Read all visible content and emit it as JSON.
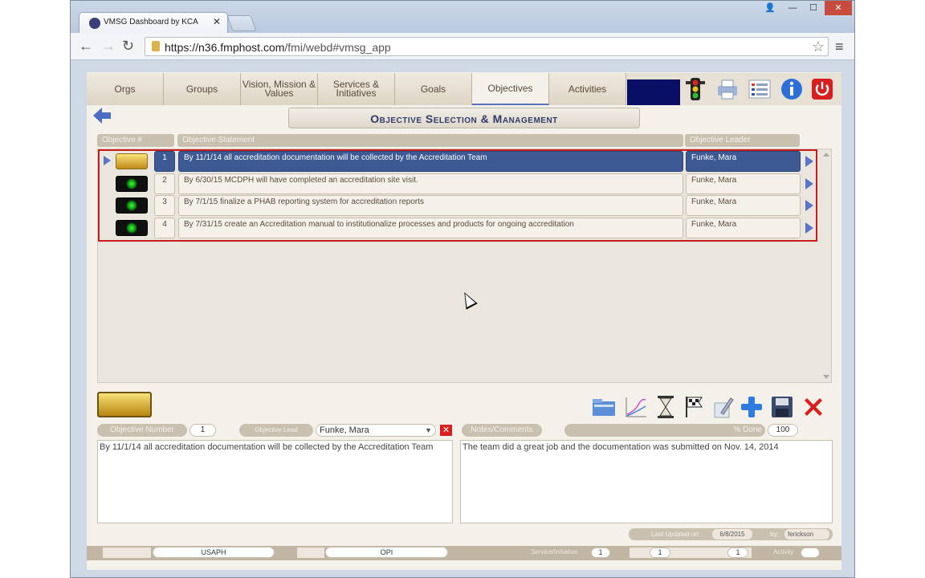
{
  "browser": {
    "tab_title": "VMSG Dashboard by KCA",
    "url_host": "https://n36.fmphost.com",
    "url_path": "/fmi/webd#vmsg_app",
    "controls": {
      "user": "👤",
      "min": "—",
      "max": "☐",
      "close": "✕"
    }
  },
  "nav": {
    "tabs": [
      {
        "label": "Orgs"
      },
      {
        "label": "Groups"
      },
      {
        "label": "Vision, Mission & Values"
      },
      {
        "label": "Services & Initiatives"
      },
      {
        "label": "Goals"
      },
      {
        "label": "Objectives"
      },
      {
        "label": "Activities"
      }
    ],
    "icons": [
      "traffic-light-icon",
      "printer-icon",
      "report-list-icon",
      "info-icon",
      "power-icon"
    ]
  },
  "page": {
    "title": "Objective Selection & Management"
  },
  "table": {
    "headers": {
      "num": "Objective #",
      "statement": "Objective Statement",
      "leader": "Objective Leader"
    },
    "rows": [
      {
        "num": "1",
        "statement": "By 11/1/14 all accreditation documentation will be collected by the Accreditation Team",
        "leader": "Funke, Mara",
        "status": "gold",
        "selected": true
      },
      {
        "num": "2",
        "statement": "By 6/30/15 MCDPH will have completed an accreditation site visit.",
        "leader": "Funke, Mara",
        "status": "green",
        "selected": false
      },
      {
        "num": "3",
        "statement": "By 7/1/15 finalize a PHAB reporting system for accreditation reports",
        "leader": "Funke, Mara",
        "status": "green",
        "selected": false
      },
      {
        "num": "4",
        "statement": "By 7/31/15 create an Accreditation manual to institutionalize processes and products for ongoing accreditation",
        "leader": "Funke, Mara",
        "status": "green",
        "selected": false
      }
    ]
  },
  "detail": {
    "objective_number_label": "Objective Number",
    "objective_number": "1",
    "objective_lead_label": "Objective Lead",
    "objective_lead": "Funke, Mara",
    "notes_label": "Notes/Comments",
    "percent_label": "% Done",
    "percent_done": "100",
    "statement": "By 11/1/14 all accreditation documentation will be collected by the Accreditation Team",
    "notes": "The team did a great job and the documentation was submitted on Nov. 14, 2014",
    "last_updated_label": "Last Updated on:",
    "last_updated": "6/8/2015",
    "by_label": "by:",
    "by": "ferickson"
  },
  "status": {
    "org": "USAPH",
    "group": "OPI",
    "service_label": "Service/Initiative",
    "service": "1",
    "goal": "1",
    "objective": "1",
    "activity_label": "Activity"
  }
}
